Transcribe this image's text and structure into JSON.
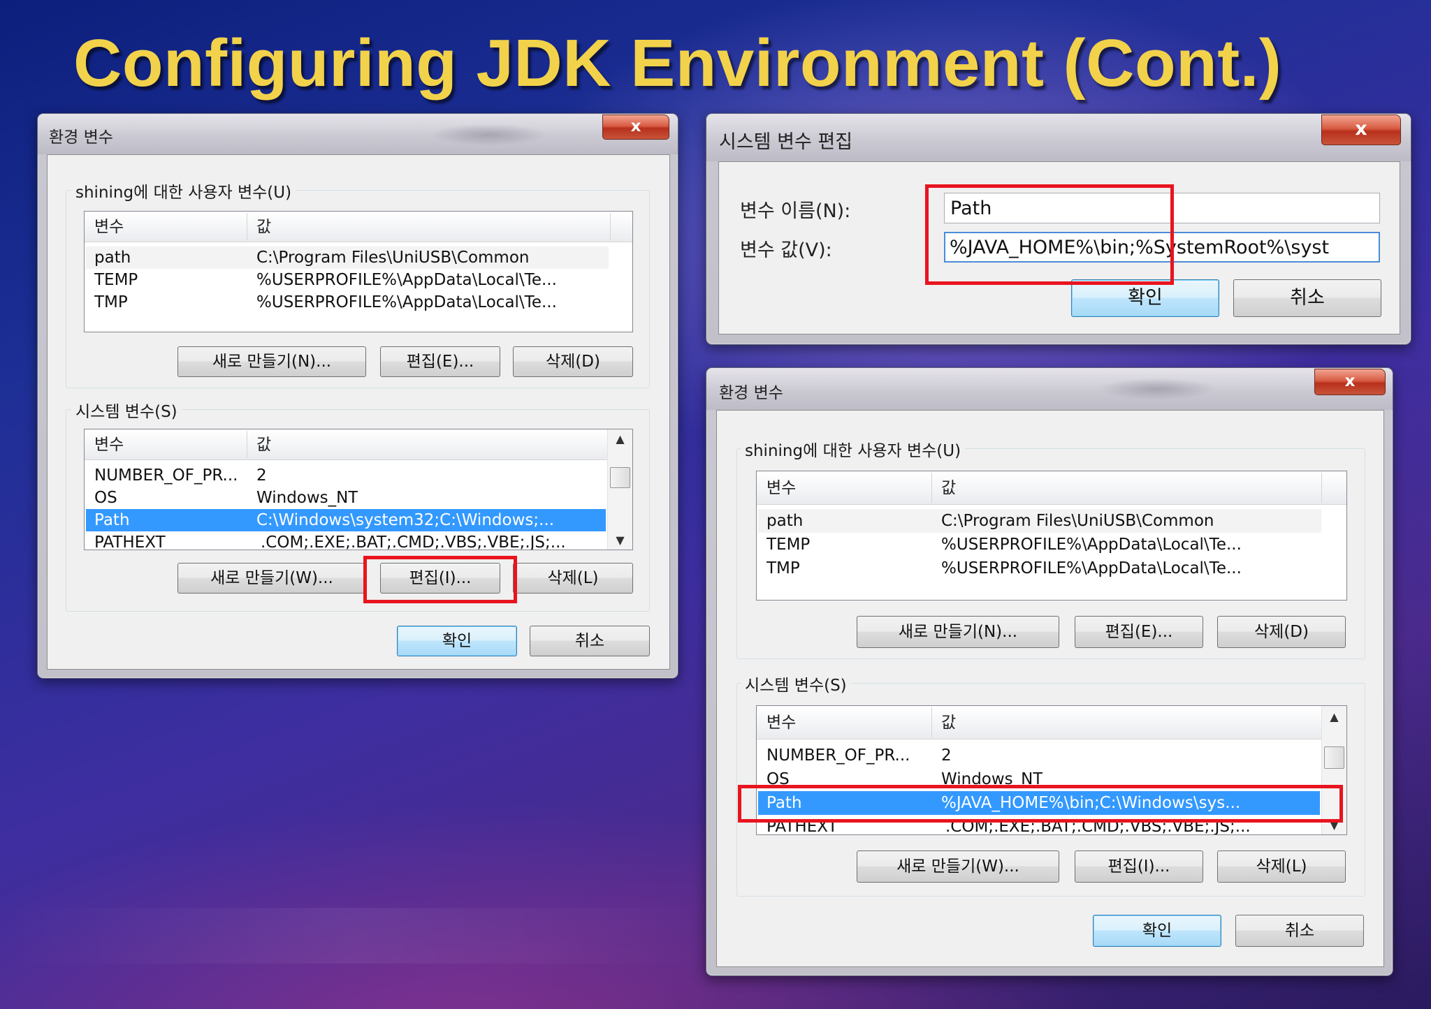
{
  "slide": {
    "title": "Configuring JDK Environment (Cont.)"
  },
  "env_dialog": {
    "title": "환경 변수",
    "close": "x",
    "user_group_label": "shining에 대한 사용자 변수(U)",
    "system_group_label": "시스템 변수(S)",
    "col_var": "변수",
    "col_val": "값",
    "user_rows": [
      {
        "name": "path",
        "value": "C:\\Program Files\\UniUSB\\Common"
      },
      {
        "name": "TEMP",
        "value": "%USERPROFILE%\\AppData\\Local\\Te..."
      },
      {
        "name": "TMP",
        "value": "%USERPROFILE%\\AppData\\Local\\Te..."
      }
    ],
    "user_buttons": {
      "new": "새로 만들기(N)...",
      "edit": "편집(E)...",
      "delete": "삭제(D)"
    },
    "system_rows": [
      {
        "name": "NUMBER_OF_PR...",
        "value": "2"
      },
      {
        "name": "OS",
        "value": "Windows_NT"
      },
      {
        "name": "Path",
        "value": "C:\\Windows\\system32;C:\\Windows;..."
      },
      {
        "name": "PATHEXT",
        "value": ".COM;.EXE;.BAT;.CMD;.VBS;.VBE;.JS;..."
      }
    ],
    "system_buttons": {
      "new": "새로 만들기(W)...",
      "edit": "편집(I)...",
      "delete": "삭제(L)"
    },
    "ok": "확인",
    "cancel": "취소"
  },
  "edit_dialog": {
    "title": "시스템 변수 편집",
    "close": "x",
    "name_label": "변수 이름(N):",
    "value_label": "변수 값(V):",
    "name_value": "Path",
    "value_value": "%JAVA_HOME%\\bin;%SystemRoot%\\syst",
    "ok": "확인",
    "cancel": "취소"
  },
  "env_dialog_after": {
    "title": "환경 변수",
    "close": "x",
    "user_group_label": "shining에 대한 사용자 변수(U)",
    "system_group_label": "시스템 변수(S)",
    "col_var": "변수",
    "col_val": "값",
    "user_rows": [
      {
        "name": "path",
        "value": "C:\\Program Files\\UniUSB\\Common"
      },
      {
        "name": "TEMP",
        "value": "%USERPROFILE%\\AppData\\Local\\Te..."
      },
      {
        "name": "TMP",
        "value": "%USERPROFILE%\\AppData\\Local\\Te..."
      }
    ],
    "user_buttons": {
      "new": "새로 만들기(N)...",
      "edit": "편집(E)...",
      "delete": "삭제(D)"
    },
    "system_rows": [
      {
        "name": "NUMBER_OF_PR...",
        "value": "2"
      },
      {
        "name": "OS",
        "value": "Windows_NT"
      },
      {
        "name": "Path",
        "value": "%JAVA_HOME%\\bin;C:\\Windows\\sys..."
      },
      {
        "name": "PATHEXT",
        "value": ".COM;.EXE;.BAT;.CMD;.VBS;.VBE;.JS;..."
      }
    ],
    "system_buttons": {
      "new": "새로 만들기(W)...",
      "edit": "편집(I)...",
      "delete": "삭제(L)"
    },
    "ok": "확인",
    "cancel": "취소"
  },
  "colors": {
    "title": "#f2d24a",
    "highlight": "#e8141e",
    "selection": "#3399ff"
  }
}
